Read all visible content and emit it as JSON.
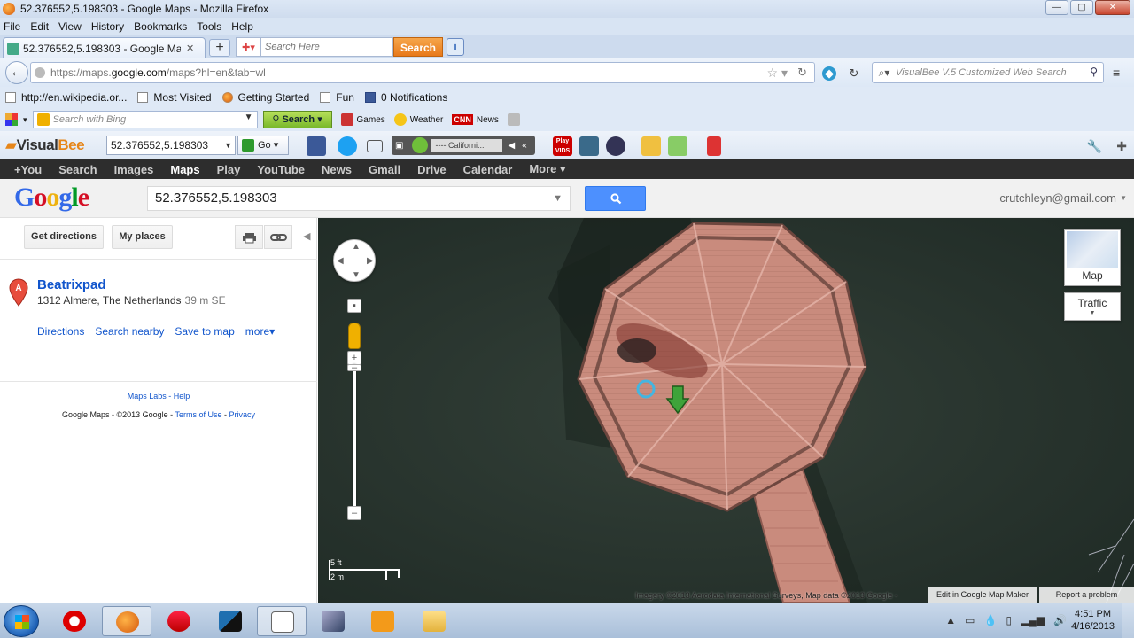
{
  "window": {
    "title": "52.376552,5.198303 - Google Maps - Mozilla Firefox"
  },
  "menu": [
    "File",
    "Edit",
    "View",
    "History",
    "Bookmarks",
    "Tools",
    "Help"
  ],
  "tabs": [
    {
      "label": "52.376552,5.198303 - Google Maps"
    }
  ],
  "tab_search": {
    "placeholder": "Search Here",
    "button": "Search"
  },
  "address": {
    "prefix": "https://maps.",
    "domain": "google.com",
    "path": "/maps?hl=en&tab=wl"
  },
  "visualbee_search": {
    "placeholder": "VisualBee V.5 Customized Web Search"
  },
  "bookmarks": [
    {
      "label": "http://en.wikipedia.or...",
      "icon": "page-icon"
    },
    {
      "label": "Most Visited",
      "icon": "page-icon"
    },
    {
      "label": "Getting Started",
      "icon": "firefox-icon"
    },
    {
      "label": "Fun",
      "icon": "folder-icon"
    },
    {
      "label": "0 Notifications",
      "icon": "facebook-icon"
    }
  ],
  "bingbar": {
    "placeholder": "Search with Bing",
    "search_label": "Search",
    "games": "Games",
    "weather": "Weather",
    "news_brand": "CNN",
    "news": "News"
  },
  "vbbar": {
    "logo_prefix": "Visual",
    "logo_suffix": "Bee",
    "query": "52.376552,5.198303",
    "go": "Go",
    "radio_station": "---- Californi...",
    "play_vids": "Play VIDS"
  },
  "gbar": [
    "+You",
    "Search",
    "Images",
    "Maps",
    "Play",
    "YouTube",
    "News",
    "Gmail",
    "Drive",
    "Calendar",
    "More ▾"
  ],
  "gbar_active": "Maps",
  "google": {
    "query": "52.376552,5.198303",
    "account": "crutchleyn@gmail.com"
  },
  "left_panel": {
    "get_directions": "Get directions",
    "my_places": "My places",
    "result": {
      "marker": "A",
      "name": "Beatrixpad",
      "address": "1312 Almere, The Netherlands",
      "distance": "39 m SE"
    },
    "actions": [
      "Directions",
      "Search nearby",
      "Save to map",
      "more▾"
    ],
    "labs": "Maps Labs",
    "help": "Help",
    "copyright": "Google Maps - ©2013 Google -",
    "terms": "Terms of Use",
    "privacy": "Privacy"
  },
  "map": {
    "type_label": "Map",
    "traffic_label": "Traffic",
    "scale_top": "5 ft",
    "scale_bottom": "2 m",
    "attribution": "Imagery ©2013 Aerodata International Surveys, Map data ©2013 Google -",
    "map_maker": "Edit in Google Map Maker",
    "report": "Report a problem"
  },
  "taskbar": {
    "time": "4:51 PM",
    "date": "4/16/2013"
  },
  "colors": {
    "water": "#2c3832",
    "deck": "#c98b7d",
    "google_blue": "#4d90fe",
    "link": "#1155cc"
  }
}
